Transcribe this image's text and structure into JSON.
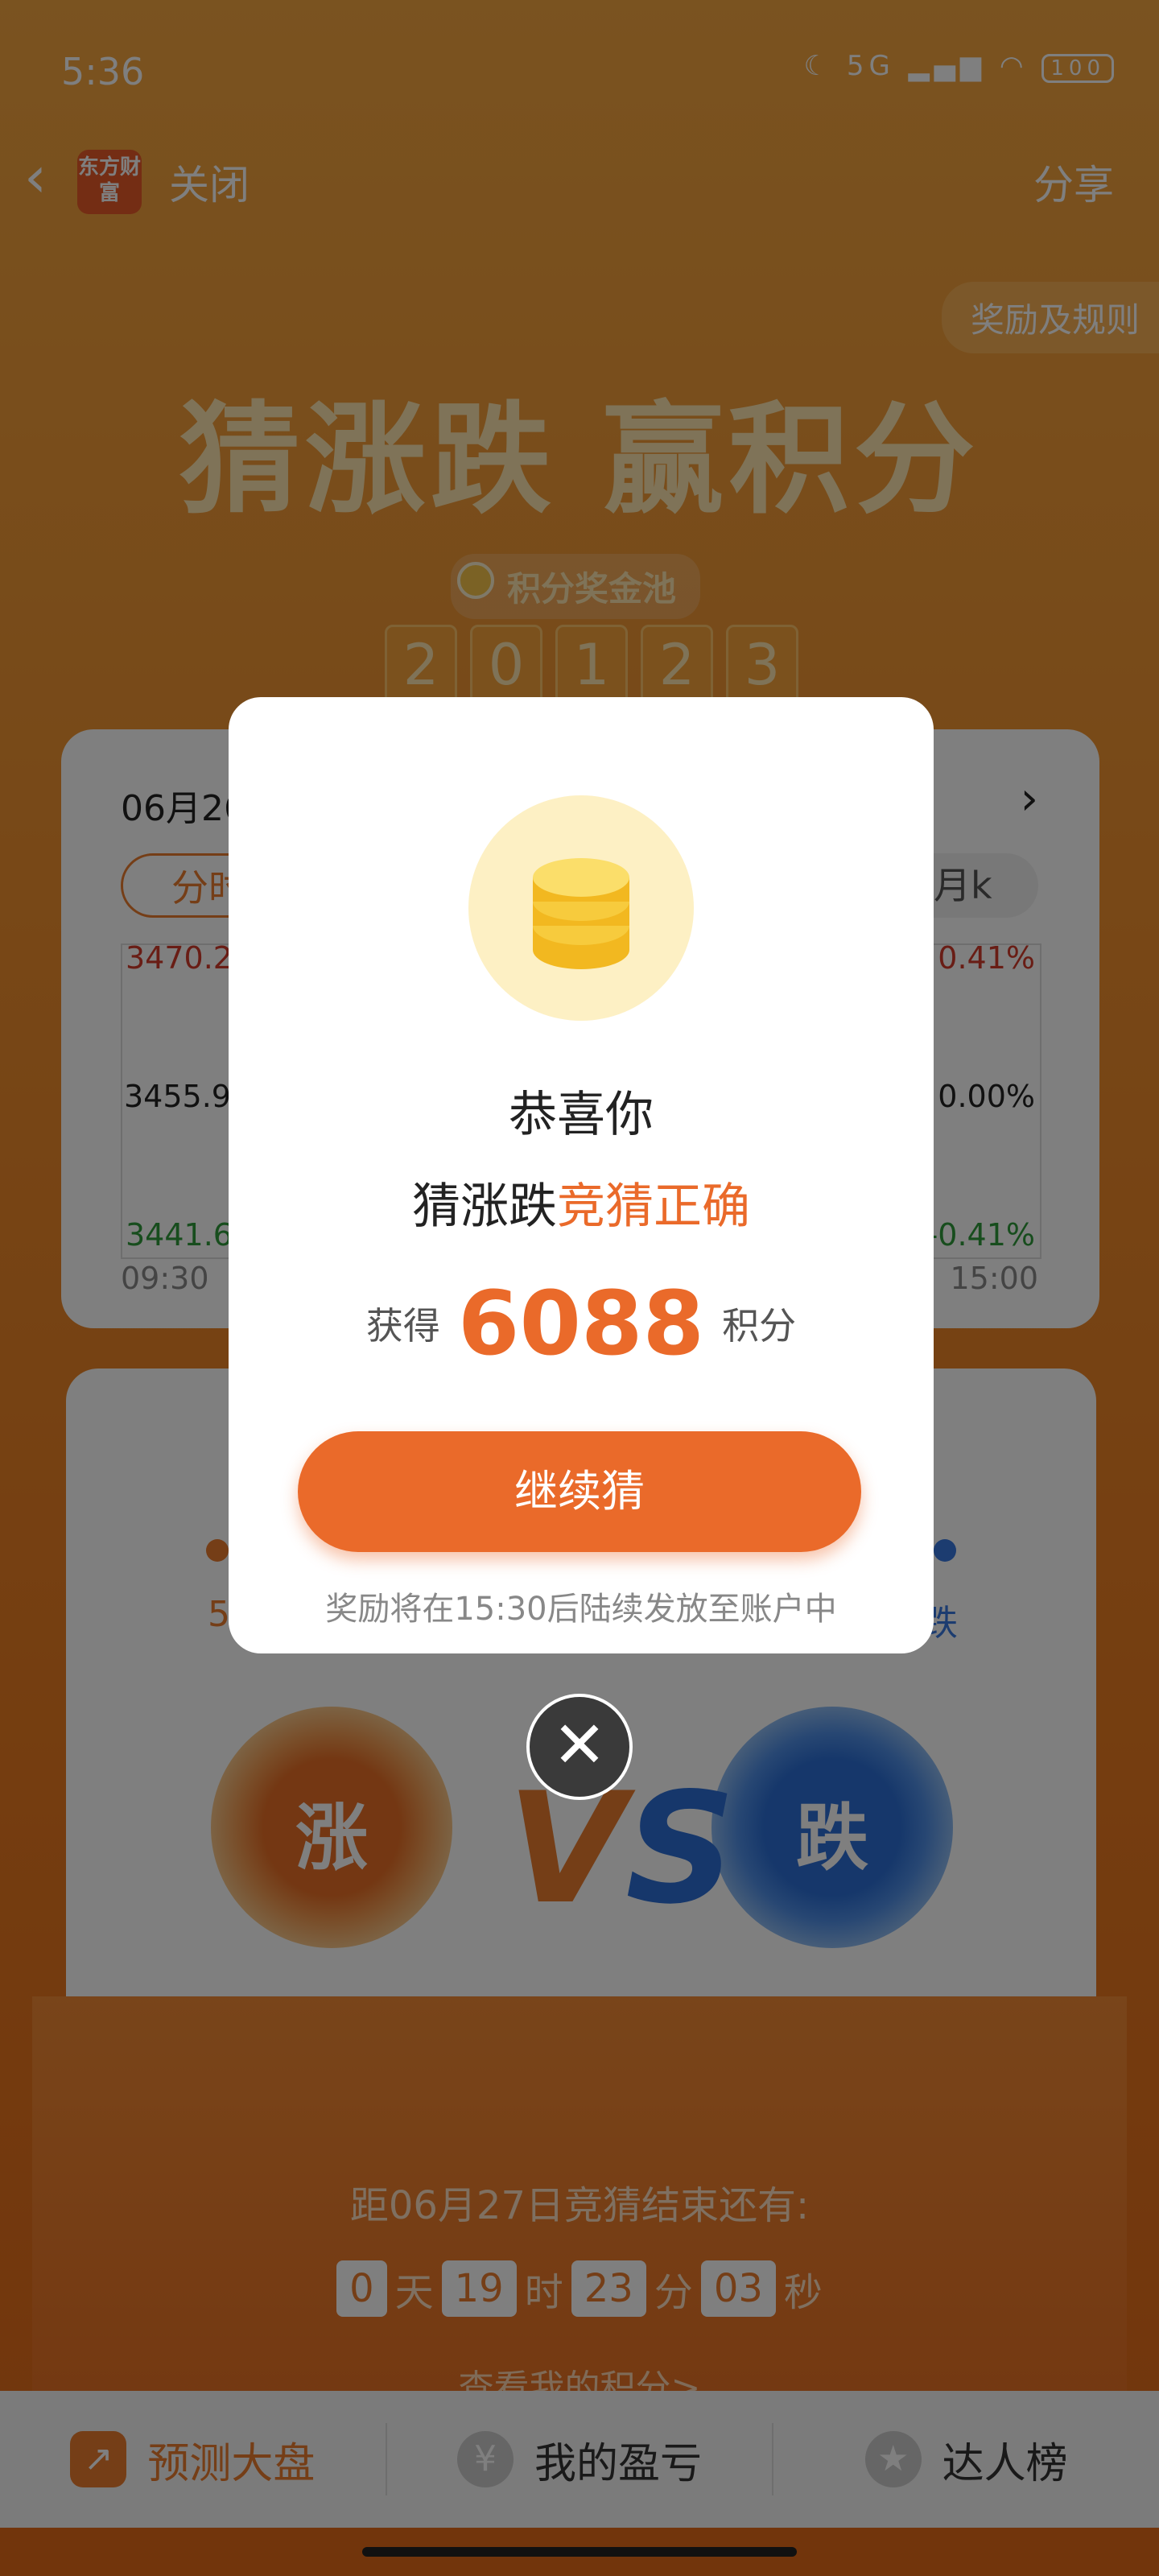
{
  "status_bar": {
    "time": "5:36",
    "network": "5G",
    "battery": "100"
  },
  "header": {
    "logo_text": "东方财富",
    "close_label": "关闭",
    "share_label": "分享"
  },
  "rules_label": "奖励及规则",
  "hero_title": "猜涨跌 赢积分",
  "pool": {
    "label": "积分奖金池",
    "digits": [
      "2",
      "0",
      "1",
      "2",
      "3"
    ]
  },
  "chart_card": {
    "date": "06月26",
    "tab_left": "分时",
    "tab_right": "月k",
    "y_high": "3470.2",
    "y_mid": "3455.9",
    "y_low": "3441.6",
    "pct_high": "0.41%",
    "pct_mid": "0.00%",
    "pct_low": "-0.41%",
    "x_start": "09:30",
    "x_end": "15:00"
  },
  "game": {
    "up_label": "涨",
    "down_label": "跌",
    "vs_label": "VS",
    "left_percent": "5",
    "right_percent": "跌"
  },
  "countdown": {
    "label": "距06月27日竞猜结束还有:",
    "days": "0",
    "days_unit": "天",
    "hours": "19",
    "hours_unit": "时",
    "minutes": "23",
    "minutes_unit": "分",
    "seconds": "03",
    "seconds_unit": "秒",
    "link": "查看我的积分>"
  },
  "bottom_nav": {
    "items": [
      {
        "label": "预测大盘",
        "icon": "trend-chart-icon"
      },
      {
        "label": "我的盈亏",
        "icon": "yen-coin-icon"
      },
      {
        "label": "达人榜",
        "icon": "medal-icon"
      }
    ]
  },
  "modal": {
    "title": "恭喜你",
    "subtitle_prefix": "猜涨跌",
    "subtitle_highlight": "竞猜正确",
    "gain_label": "获得",
    "points": "6088",
    "points_unit": "积分",
    "button_label": "继续猜",
    "note": "奖励将在15:30后陆续发放至账户中"
  },
  "colors": {
    "accent": "#ea6a2a",
    "background": "#f0902e",
    "down_blue": "#2c6fd6"
  }
}
